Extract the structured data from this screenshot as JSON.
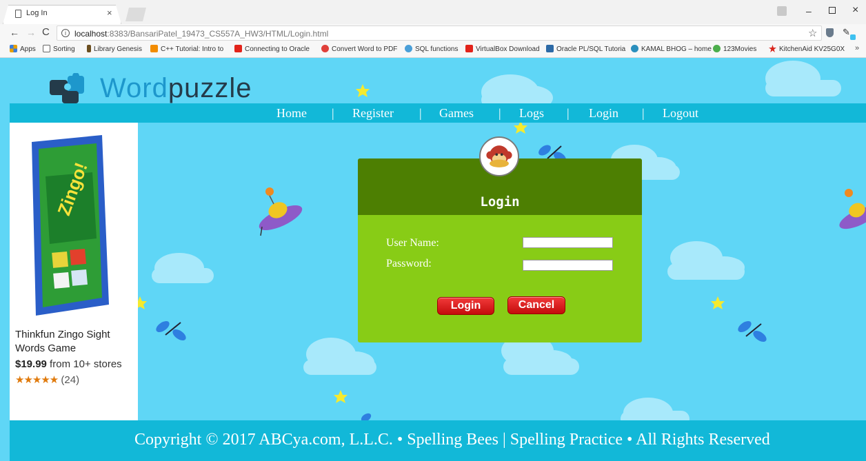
{
  "browser": {
    "tab": {
      "title": "Log In",
      "close": "×"
    },
    "window": {
      "minimize": "–",
      "close": "×"
    },
    "address": {
      "host": "localhost",
      "path": ":8383/BansariPatel_19473_CS557A_HW3/HTML/Login.html",
      "info": "i"
    },
    "nav": {
      "back": "←",
      "forward": "→",
      "reload": "C"
    },
    "toolbar": {
      "star": "☆",
      "pen": "✎"
    },
    "bookmarks": [
      {
        "label": "Apps",
        "icon": "apps-grid-icon",
        "color": "#e8a000"
      },
      {
        "label": "Sorting",
        "icon": "page-icon",
        "color": "#ffffff"
      },
      {
        "label": "Library Genesis",
        "icon": "library-icon",
        "color": "#6b4e1f"
      },
      {
        "label": "C++ Tutorial: Intro to",
        "icon": "cplusplus-icon",
        "color": "#f28c00"
      },
      {
        "label": "Connecting to Oracle",
        "icon": "oracle-icon",
        "color": "#e2231a"
      },
      {
        "label": "Convert Word to PDF",
        "icon": "convert-icon",
        "color": "#e0403a"
      },
      {
        "label": "SQL functions",
        "icon": "sql-icon",
        "color": "#4a9fd8"
      },
      {
        "label": "VirtualBox Download",
        "icon": "oracle-icon",
        "color": "#e2231a"
      },
      {
        "label": "Oracle PL/SQL Tutoria",
        "icon": "tutorial-icon",
        "color": "#2d6aa6"
      },
      {
        "label": "KAMAL BHOG – home",
        "icon": "wordpress-icon",
        "color": "#2a8fbd"
      },
      {
        "label": "123Movies",
        "icon": "movie-icon",
        "color": "#4cae4c"
      },
      {
        "label": "KitchenAid KV25G0X",
        "icon": "star-icon",
        "color": "#d9251c"
      }
    ],
    "bookmarks_more": "»"
  },
  "site": {
    "logo": {
      "word1": "Word",
      "word2": "puzzle"
    },
    "nav": [
      {
        "label": "Home"
      },
      {
        "label": "Register"
      },
      {
        "label": "Games"
      },
      {
        "label": "Logs"
      },
      {
        "label": "Login"
      },
      {
        "label": "Logout"
      }
    ],
    "nav_separator": "|",
    "ad": {
      "title": "Thinkfun Zingo Sight Words Game",
      "price": "$19.99",
      "price_suffix": " from 10+ stores",
      "stars": "★★★★★",
      "reviews": "(24)",
      "box_text": "Zingo!"
    },
    "login": {
      "title": "Login",
      "username_label": "User Name:",
      "password_label": "Password:",
      "username_value": "",
      "password_value": "",
      "login_button": "Login",
      "cancel_button": "Cancel"
    },
    "footer": "Copyright © 2017 ABCya.com, L.L.C. • Spelling Bees | Spelling Practice • All Rights Reserved",
    "colors": {
      "sky": "#5fd6f6",
      "bar": "#12b8d8",
      "panel": "#88cc16",
      "panel_header": "#4d7f02",
      "button": "#d81c1c"
    }
  }
}
